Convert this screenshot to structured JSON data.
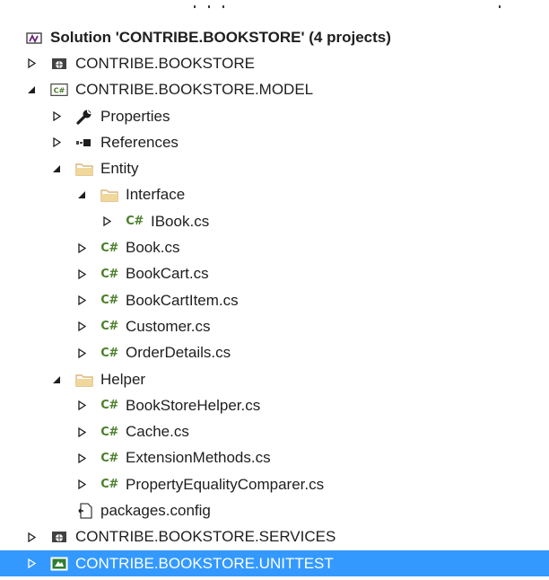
{
  "tree": {
    "solution": {
      "label": "Solution 'CONTRIBE.BOOKSTORE' (4 projects)",
      "icon": "solution-icon"
    },
    "projects": [
      {
        "label": "CONTRIBE.BOOKSTORE",
        "icon": "web-project-icon",
        "expanded": false
      },
      {
        "label": "CONTRIBE.BOOKSTORE.MODEL",
        "icon": "csharp-project-icon",
        "expanded": true,
        "children": [
          {
            "label": "Properties",
            "icon": "wrench-icon",
            "expanded": false
          },
          {
            "label": "References",
            "icon": "references-icon",
            "expanded": false
          },
          {
            "label": "Entity",
            "icon": "folder-icon",
            "expanded": true,
            "children": [
              {
                "label": "Interface",
                "icon": "folder-icon",
                "expanded": true,
                "children": [
                  {
                    "label": "IBook.cs",
                    "icon": "csharp-file-icon"
                  }
                ]
              },
              {
                "label": "Book.cs",
                "icon": "csharp-file-icon"
              },
              {
                "label": "BookCart.cs",
                "icon": "csharp-file-icon"
              },
              {
                "label": "BookCartItem.cs",
                "icon": "csharp-file-icon"
              },
              {
                "label": "Customer.cs",
                "icon": "csharp-file-icon"
              },
              {
                "label": "OrderDetails.cs",
                "icon": "csharp-file-icon"
              }
            ]
          },
          {
            "label": "Helper",
            "icon": "folder-icon",
            "expanded": true,
            "children": [
              {
                "label": "BookStoreHelper.cs",
                "icon": "csharp-file-icon"
              },
              {
                "label": "Cache.cs",
                "icon": "csharp-file-icon"
              },
              {
                "label": "ExtensionMethods.cs",
                "icon": "csharp-file-icon"
              },
              {
                "label": "PropertyEqualityComparer.cs",
                "icon": "csharp-file-icon"
              }
            ]
          },
          {
            "label": "packages.config",
            "icon": "config-file-icon"
          }
        ]
      },
      {
        "label": "CONTRIBE.BOOKSTORE.SERVICES",
        "icon": "web-project-icon",
        "expanded": false
      },
      {
        "label": "CONTRIBE.BOOKSTORE.UNITTEST",
        "icon": "test-project-icon",
        "expanded": false,
        "selected": true
      }
    ]
  },
  "glyphs": {
    "csharp": "C#",
    "csharp_project": "C#"
  },
  "colors": {
    "selection": "#3399ff",
    "csharp_green": "#4b7e2a",
    "folder_yellow": "#dcb67a"
  }
}
